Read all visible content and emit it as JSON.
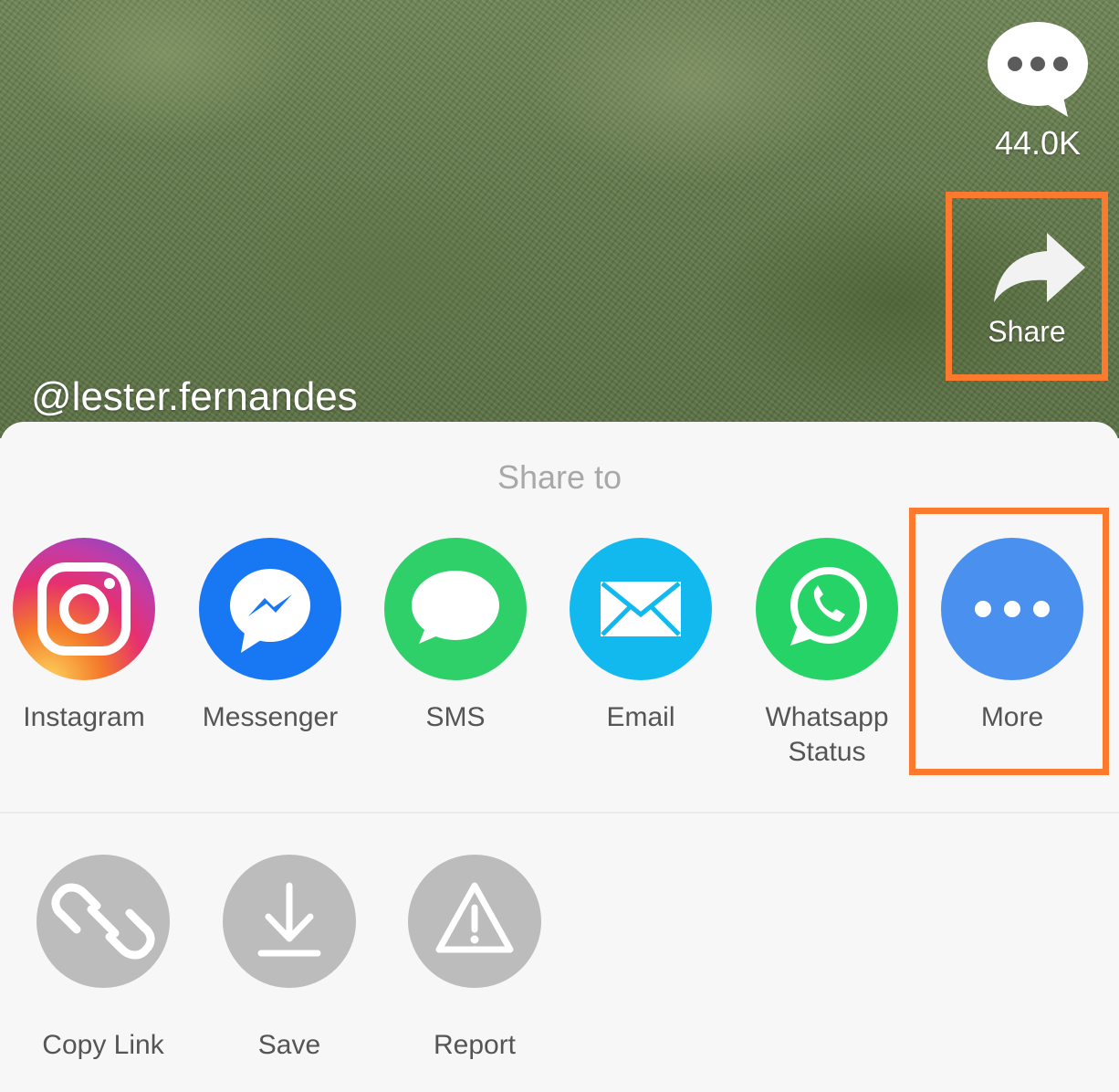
{
  "video": {
    "username": "@lester.fernandes",
    "comment_count": "44.0K",
    "share_label": "Share"
  },
  "sheet": {
    "title": "Share to",
    "targets": [
      {
        "label": "Instagram",
        "icon": "instagram-icon"
      },
      {
        "label": "Messenger",
        "icon": "messenger-icon"
      },
      {
        "label": "SMS",
        "icon": "sms-icon"
      },
      {
        "label": "Email",
        "icon": "email-icon"
      },
      {
        "label": "Whatsapp Status",
        "icon": "whatsapp-icon"
      },
      {
        "label": "More",
        "icon": "more-icon"
      }
    ],
    "actions": [
      {
        "label": "Copy Link",
        "icon": "link-icon"
      },
      {
        "label": "Save",
        "icon": "download-icon"
      },
      {
        "label": "Report",
        "icon": "warning-icon"
      }
    ]
  },
  "colors": {
    "highlight": "#fc7a2d",
    "messenger": "#1877f2",
    "sms": "#2fcf6a",
    "email": "#12b9ef",
    "whatsapp": "#25d366",
    "more": "#4a90ee",
    "action_gray": "#bcbcbc"
  }
}
